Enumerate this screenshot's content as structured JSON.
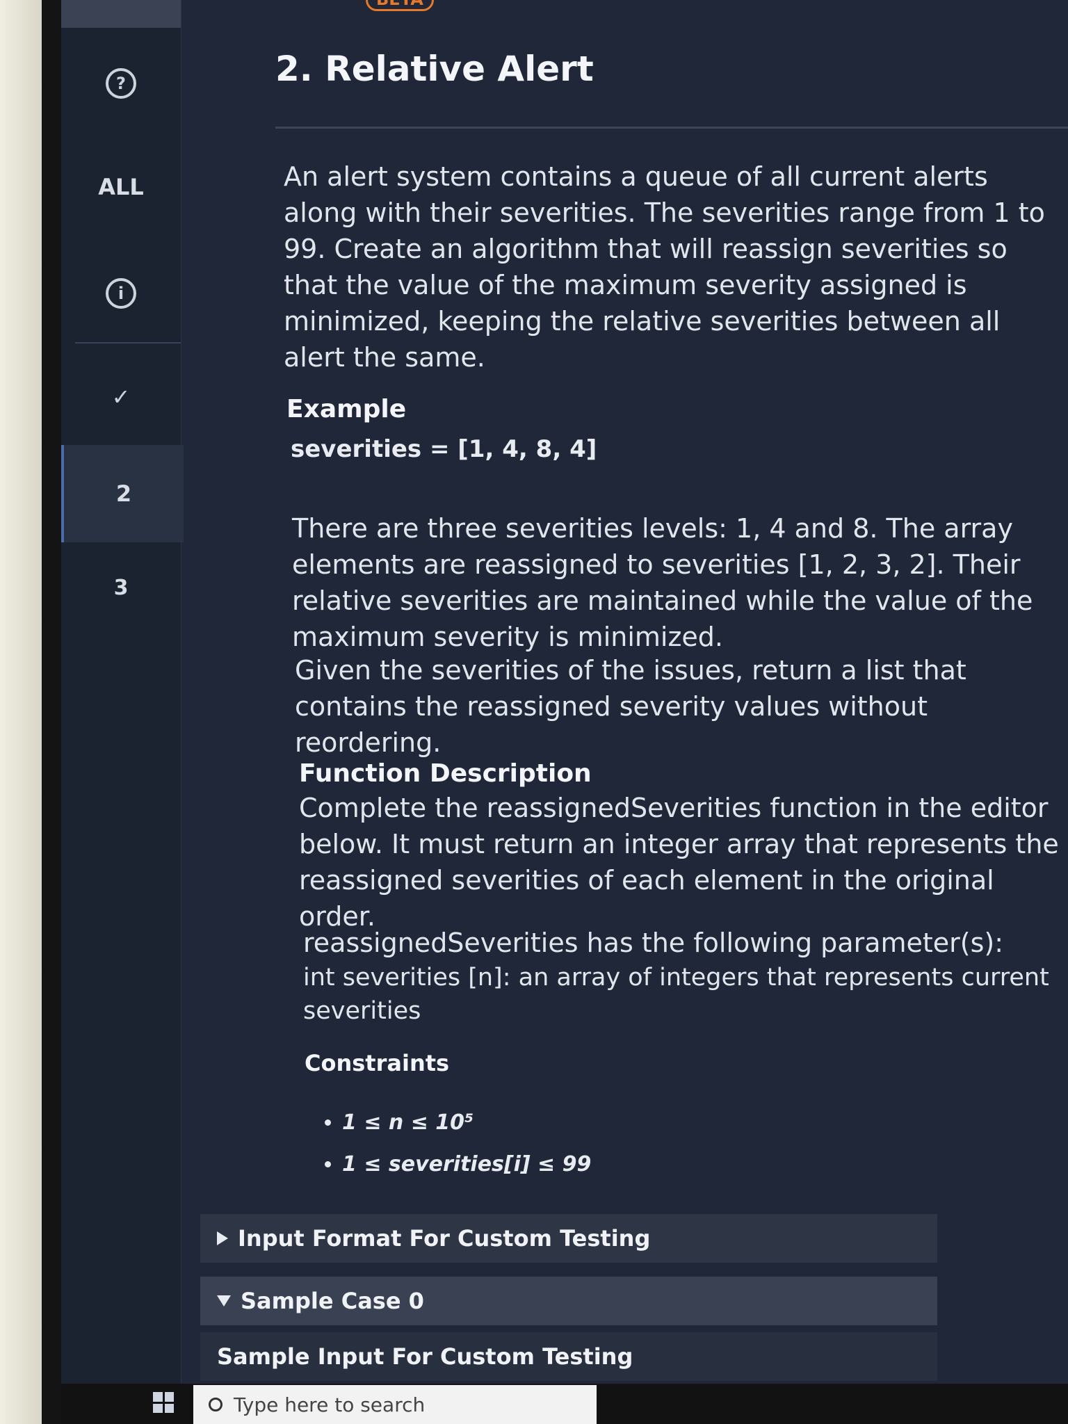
{
  "badge": "BETA",
  "sidebar": {
    "all_label": "ALL",
    "items": [
      "2",
      "3"
    ]
  },
  "question": {
    "title": "2. Relative Alert",
    "intro": "An alert system contains a queue of all current alerts along with their severities. The severities range from 1 to 99. Create an algorithm that will reassign severities so that the value of the maximum severity assigned is minimized, keeping the relative severities between all alert the same.",
    "example_heading": "Example",
    "example_value": "severities = [1, 4, 8, 4]",
    "example_explanation": "There are three severities levels: 1, 4 and 8. The array elements are reassigned to severities [1, 2, 3, 2]. Their relative severities are maintained while the value of the maximum severity is minimized.",
    "task": "Given the severities of the issues, return a list that contains the reassigned severity values without reordering.",
    "function_heading": "Function Description",
    "function_text": "Complete the reassignedSeverities function in the editor below. It must return an integer array that represents the reassigned severities of each element in the original order.",
    "params_line": "reassignedSeverities has the following parameter(s):",
    "param_detail": "int severities [n]: an array of integers that represents current severities",
    "constraints_heading": "Constraints",
    "constraints": [
      "1 ≤ n ≤ 10⁵",
      "1 ≤ severities[i] ≤ 99"
    ],
    "input_format": "Input Format For Custom Testing",
    "sample_case": "Sample Case 0",
    "sample_input": "Sample Input For Custom Testing"
  },
  "taskbar": {
    "search_placeholder": "Type here to search"
  }
}
